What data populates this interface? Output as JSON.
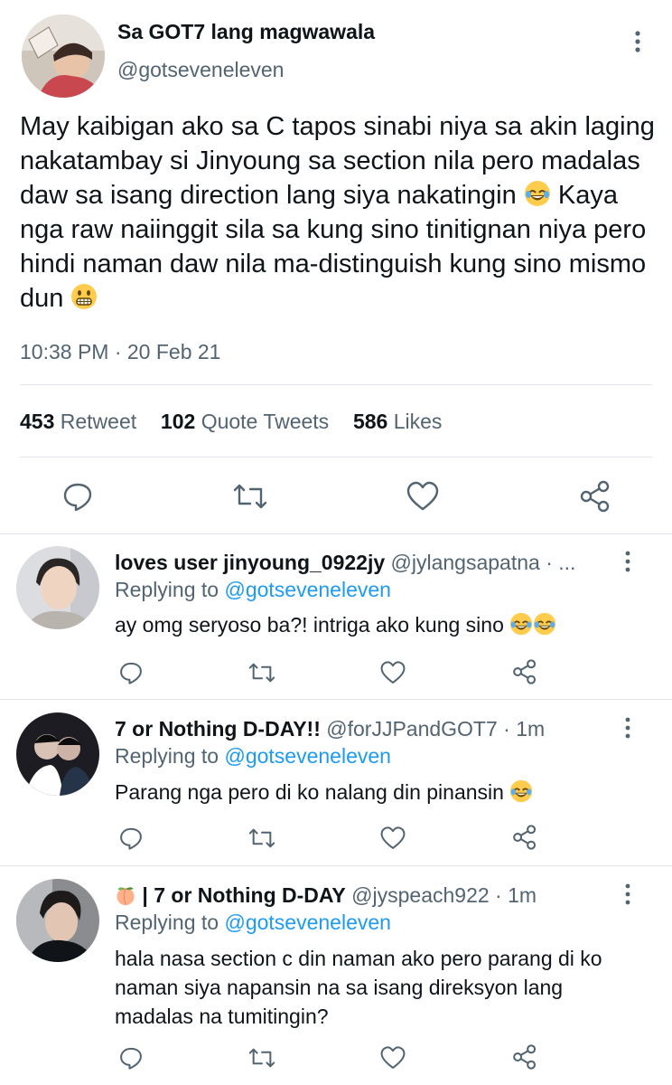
{
  "main_tweet": {
    "display_name": "Sa GOT7 lang magwawala",
    "handle": "@gotseveneleven",
    "text_before": "May kaibigan ako sa C tapos sinabi niya sa akin laging nakatambay si Jinyoung sa section nila pero madalas daw sa isang direction lang siya nakatingin",
    "text_middle": "Kaya nga raw naiinggit sila sa kung sino tinitignan niya pero hindi naman daw nila ma-distinguish kung sino mismo dun",
    "emoji_1": "joy-emoji",
    "emoji_2": "grimacing-emoji",
    "timestamp": "10:38 PM · 20 Feb 21",
    "stats": {
      "retweets_count": "453",
      "retweets_label": "Retweet",
      "quotes_count": "102",
      "quotes_label": "Quote Tweets",
      "likes_count": "586",
      "likes_label": "Likes"
    }
  },
  "replies": [
    {
      "display_name": "loves user jinyoung_0922jy",
      "handle_meta": "@jylangsapatna · ...",
      "replying_label": "Replying to",
      "replying_handle": "@gotseveneleven",
      "text": "ay omg seryoso ba?! intriga ako kung sino",
      "emojis": [
        "joy-emoji",
        "joy-emoji"
      ]
    },
    {
      "display_name": "7 or Nothing D-DAY!!",
      "handle_meta": "@forJJPandGOT7 · 1m",
      "replying_label": "Replying to",
      "replying_handle": "@gotseveneleven",
      "text": "Parang nga pero di ko nalang din pinansin",
      "emojis": [
        "joy-emoji"
      ]
    },
    {
      "display_name_prefix_emoji": "peach-emoji",
      "display_name": "| 7 or Nothing D-DAY",
      "handle_meta": "@jyspeach922 · 1m",
      "replying_label": "Replying to",
      "replying_handle": "@gotseveneleven",
      "text": "hala nasa section c din naman ako pero parang di ko naman siya napansin na sa isang direksyon lang madalas na tumitingin?"
    }
  ],
  "colors": {
    "text": "#0f1419",
    "muted": "#536471",
    "link": "#1d9bf0",
    "divider": "#e1e6ea"
  }
}
